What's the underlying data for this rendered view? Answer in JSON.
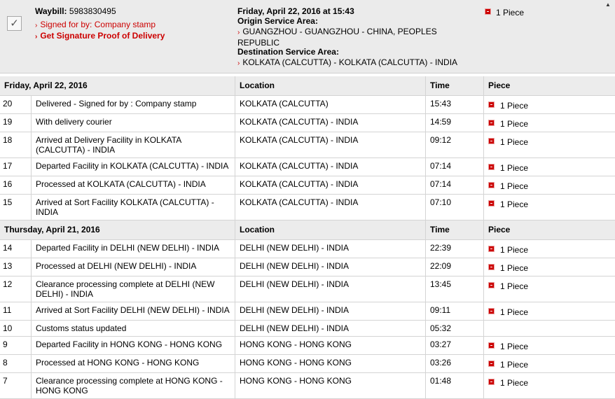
{
  "summary": {
    "waybill_label": "Waybill: ",
    "waybill_number": "5983830495",
    "signed_for": "Signed for by: Company stamp",
    "signature_link": "Get Signature Proof of Delivery",
    "ship_date": "Friday, April 22, 2016 at 15:43",
    "origin_label": "Origin Service Area:",
    "origin_value": "GUANGZHOU - GUANGZHOU - CHINA, PEOPLES REPUBLIC",
    "destination_label": "Destination Service Area:",
    "destination_value": "KOLKATA (CALCUTTA) - KOLKATA (CALCUTTA) - INDIA",
    "pieces": "1 Piece",
    "checkmark": "✓"
  },
  "columns": {
    "location": "Location",
    "time": "Time",
    "piece": "Piece"
  },
  "groups": [
    {
      "date": "Friday, April 22, 2016",
      "rows": [
        {
          "num": "20",
          "desc": "Delivered - Signed for by : Company stamp",
          "loc": "KOLKATA (CALCUTTA)",
          "time": "15:43",
          "piece": "1 Piece"
        },
        {
          "num": "19",
          "desc": "With delivery courier",
          "loc": "KOLKATA (CALCUTTA) - INDIA",
          "time": "14:59",
          "piece": "1 Piece"
        },
        {
          "num": "18",
          "desc": "Arrived at Delivery Facility in KOLKATA (CALCUTTA) - INDIA",
          "loc": "KOLKATA (CALCUTTA) - INDIA",
          "time": "09:12",
          "piece": "1 Piece"
        },
        {
          "num": "17",
          "desc": "Departed Facility in KOLKATA (CALCUTTA) - INDIA",
          "loc": "KOLKATA (CALCUTTA) - INDIA",
          "time": "07:14",
          "piece": "1 Piece"
        },
        {
          "num": "16",
          "desc": "Processed at KOLKATA (CALCUTTA) - INDIA",
          "loc": "KOLKATA (CALCUTTA) - INDIA",
          "time": "07:14",
          "piece": "1 Piece"
        },
        {
          "num": "15",
          "desc": "Arrived at Sort Facility KOLKATA (CALCUTTA) - INDIA",
          "loc": "KOLKATA (CALCUTTA) - INDIA",
          "time": "07:10",
          "piece": "1 Piece"
        }
      ]
    },
    {
      "date": "Thursday, April 21, 2016",
      "rows": [
        {
          "num": "14",
          "desc": "Departed Facility in DELHI (NEW DELHI) - INDIA",
          "loc": "DELHI (NEW DELHI) - INDIA",
          "time": "22:39",
          "piece": "1 Piece"
        },
        {
          "num": "13",
          "desc": "Processed at DELHI (NEW DELHI) - INDIA",
          "loc": "DELHI (NEW DELHI) - INDIA",
          "time": "22:09",
          "piece": "1 Piece"
        },
        {
          "num": "12",
          "desc": "Clearance processing complete at DELHI (NEW DELHI) - INDIA",
          "loc": "DELHI (NEW DELHI) - INDIA",
          "time": "13:45",
          "piece": "1 Piece"
        },
        {
          "num": "11",
          "desc": "Arrived at Sort Facility DELHI (NEW DELHI) - INDIA",
          "loc": "DELHI (NEW DELHI) - INDIA",
          "time": "09:11",
          "piece": "1 Piece"
        },
        {
          "num": "10",
          "desc": "Customs status updated",
          "loc": "DELHI (NEW DELHI) - INDIA",
          "time": "05:32",
          "piece": ""
        },
        {
          "num": "9",
          "desc": "Departed Facility in HONG KONG - HONG KONG",
          "loc": "HONG KONG - HONG KONG",
          "time": "03:27",
          "piece": "1 Piece"
        },
        {
          "num": "8",
          "desc": "Processed at HONG KONG - HONG KONG",
          "loc": "HONG KONG - HONG KONG",
          "time": "03:26",
          "piece": "1 Piece"
        },
        {
          "num": "7",
          "desc": "Clearance processing complete at HONG KONG - HONG KONG",
          "loc": "HONG KONG - HONG KONG",
          "time": "01:48",
          "piece": "1 Piece"
        }
      ]
    }
  ],
  "colors": {
    "accent_red": "#cc0000",
    "header_bg": "#ececec",
    "summary_bg": "#ebebeb"
  },
  "icons": {
    "piece": "red-square-icon",
    "link": "red-caret-icon",
    "check": "checkmark-icon"
  }
}
